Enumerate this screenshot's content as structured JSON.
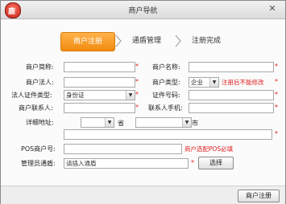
{
  "window": {
    "title": "商户导航",
    "close_glyph": "✕",
    "logo_glyph": "鹿"
  },
  "steps": [
    "商户注册",
    "通盾管理",
    "注册完成"
  ],
  "form": {
    "merchant_short_name": {
      "label": "商户简称:",
      "value": ""
    },
    "merchant_name": {
      "label": "商户名称:",
      "value": ""
    },
    "legal_person": {
      "label": "商户法人:",
      "value": ""
    },
    "merchant_type": {
      "label": "商户类型:",
      "value": "企业",
      "note": "注册后不能修改"
    },
    "legal_id_type": {
      "label": "法人证件类型:",
      "value": "身份证"
    },
    "id_number": {
      "label": "证件号码:",
      "value": ""
    },
    "contact": {
      "label": "商户联系人:",
      "value": ""
    },
    "contact_phone": {
      "label": "联系人手机:",
      "value": ""
    },
    "address": {
      "label": "详细地址:",
      "province_suffix": "省",
      "city_suffix": "市",
      "value": ""
    },
    "pos_merchant_no": {
      "label": "POS商户号:",
      "value": "",
      "note": "商户选配POS必填"
    },
    "admin_shield": {
      "label": "管理员通盾:",
      "placeholder": "请插入通盾",
      "button": "选择"
    }
  },
  "required_mark": "*",
  "footer": {
    "register_button": "商户注册"
  },
  "colors": {
    "accent": "#f28b0f",
    "required": "#e02020"
  }
}
